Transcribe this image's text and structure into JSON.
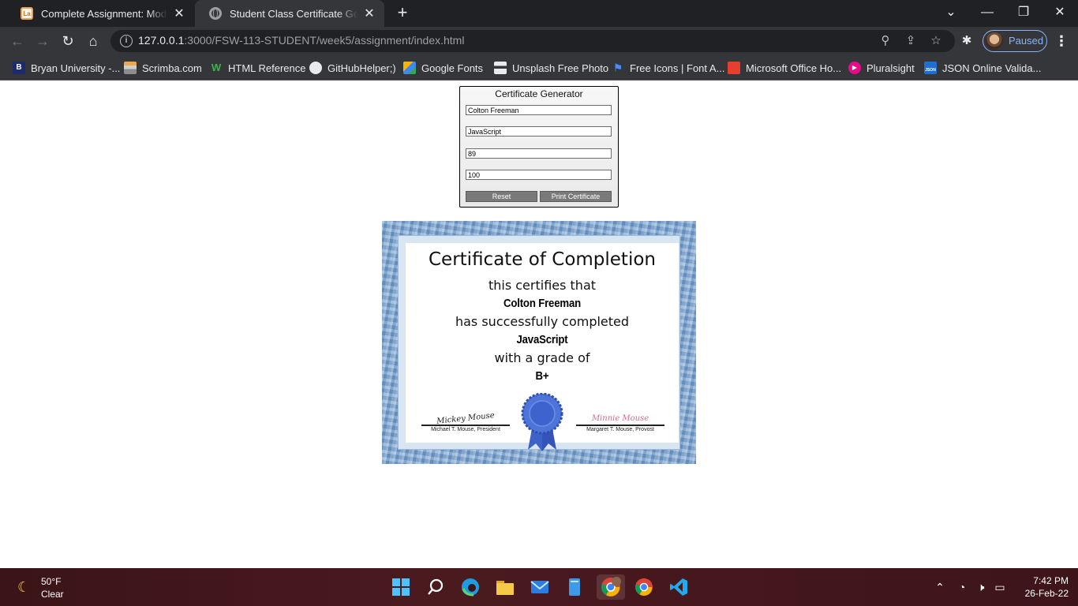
{
  "browser": {
    "tabs": [
      {
        "title": "Complete Assignment: Modules",
        "icon": "la-favicon-icon"
      },
      {
        "title": "Student Class Certificate Generat",
        "icon": "globe-icon"
      }
    ],
    "url_host": "127.0.0.1",
    "url_path": ":3000/FSW-113-STUDENT/week5/assignment/index.html",
    "profile_status": "Paused",
    "bookmarks": [
      {
        "label": "Bryan University -...",
        "icon": "bryan-university-icon"
      },
      {
        "label": "Scrimba.com",
        "icon": "scrimba-icon"
      },
      {
        "label": "HTML Reference",
        "icon": "html-reference-icon"
      },
      {
        "label": "GitHubHelper;)",
        "icon": "github-icon"
      },
      {
        "label": "Google Fonts",
        "icon": "google-fonts-icon"
      },
      {
        "label": "Unsplash Free Photo",
        "icon": "unsplash-icon"
      },
      {
        "label": "Free Icons | Font A...",
        "icon": "font-awesome-icon"
      },
      {
        "label": "Microsoft Office Ho...",
        "icon": "office-icon"
      },
      {
        "label": "Pluralsight",
        "icon": "pluralsight-icon"
      },
      {
        "label": "JSON Online Valida...",
        "icon": "json-icon"
      }
    ]
  },
  "form": {
    "title": "Certificate Generator",
    "student_name": "Colton Freeman",
    "class_name": "JavaScript",
    "score": "89",
    "max_score": "100",
    "reset_label": "Reset",
    "print_label": "Print Certificate"
  },
  "certificate": {
    "heading": "Certificate of Completion",
    "line1": "this certifies that",
    "student": "Colton Freeman",
    "line2": "has successfully completed",
    "course": "JavaScript",
    "line3": "with a grade of",
    "grade": "B+",
    "sig_left_script": "Mickey Mouse",
    "sig_left_caption": "Michael T. Mouse, President",
    "sig_right_script": "Minnie Mouse",
    "sig_right_caption": "Margaret T. Mouse, Provost"
  },
  "taskbar": {
    "temperature": "50°F",
    "condition": "Clear",
    "time": "7:42 PM",
    "date": "26-Feb-22"
  },
  "colors": {
    "frame_blue": "#7ea6d0",
    "ribbon_blue": "#3f62c8",
    "profile_accent": "#8ab4f8"
  }
}
